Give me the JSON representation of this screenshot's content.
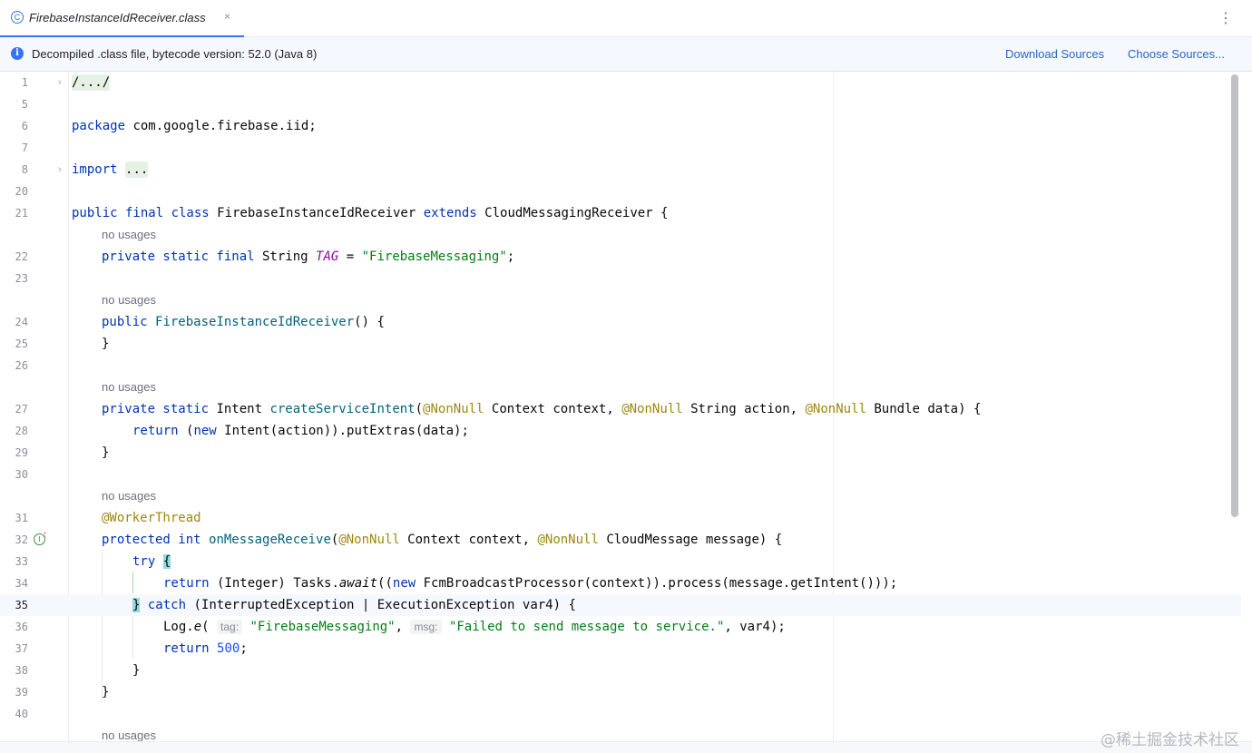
{
  "tab": {
    "icon": "class-c-icon",
    "label": "FirebaseInstanceIdReceiver.class",
    "close": "×"
  },
  "toolbar": {
    "more": "⋮"
  },
  "banner": {
    "icon": "info-icon",
    "text": "Decompiled .class file, bytecode version: 52.0 (Java 8)",
    "download_sources": "Download Sources",
    "choose_sources": "Choose Sources..."
  },
  "line_numbers": [
    "1",
    "5",
    "6",
    "7",
    "8",
    "20",
    "21",
    "22",
    "23",
    "24",
    "25",
    "26",
    "27",
    "28",
    "29",
    "30",
    "31",
    "32",
    "33",
    "34",
    "35",
    "36",
    "37",
    "38",
    "39",
    "40"
  ],
  "inlays": {
    "no_usages": "no usages"
  },
  "code": {
    "l1": "/.../",
    "l6_pkg": "package",
    "l6_rest": " com.google.firebase.iid;",
    "l8_kw": "import",
    "l8_ph": "...",
    "l21_kw": "public final class",
    "l21_name": " FirebaseInstanceIdReceiver ",
    "l21_ext": "extends",
    "l21_rest": " CloudMessagingReceiver {",
    "l22_kw": "private static final",
    "l22_type": " String ",
    "l22_const": "TAG",
    "l22_eq": " = ",
    "l22_str": "\"FirebaseMessaging\"",
    "l22_end": ";",
    "l24_kw": "public",
    "l24_fn": "FirebaseInstanceIdReceiver",
    "l24_rest": "() {",
    "l25": "}",
    "l27_kw": "private static",
    "l27_type": " Intent ",
    "l27_fn": "createServiceIntent",
    "l27_a1": "@NonNull",
    "l27_p1": " Context context, ",
    "l27_a2": "@NonNull",
    "l27_p2": " String action, ",
    "l27_a3": "@NonNull",
    "l27_p3": " Bundle data) {",
    "l28_kw": "return",
    "l28_a": " (",
    "l28_new": "new",
    "l28_rest": " Intent(action)).putExtras(data);",
    "l29": "}",
    "l31_ann": "@WorkerThread",
    "l32_kw": "protected int",
    "l32_fn": "onMessageReceive",
    "l32_a1": "@NonNull",
    "l32_p1": " Context context, ",
    "l32_a2": "@NonNull",
    "l32_p2": " CloudMessage message) {",
    "l33_kw": "try",
    "l33_brace": "{",
    "l34_kw": "return",
    "l34_a": " (Integer) Tasks.",
    "l34_await": "await",
    "l34_b": "((",
    "l34_new": "new",
    "l34_rest": " FcmBroadcastProcessor(context)).process(message.getIntent()));",
    "l35_brace": "}",
    "l35_kw": "catch",
    "l35_rest": " (InterruptedException | ExecutionException var4) {",
    "l36_a": "Log.",
    "l36_e": "e",
    "l36_b": "( ",
    "l36_tag": "tag:",
    "l36_s1": "\"FirebaseMessaging\"",
    "l36_c": ", ",
    "l36_msg": "msg:",
    "l36_s2": "\"Failed to send message to service.\"",
    "l36_end": ", var4);",
    "l37_kw": "return",
    "l37_num": "500",
    "l37_end": ";",
    "l38": "}",
    "l39": "}"
  },
  "gutter_marks": {
    "implements": "I",
    "implements_icon": "implements-up-icon"
  },
  "watermark": "@稀土掘金技术社区"
}
